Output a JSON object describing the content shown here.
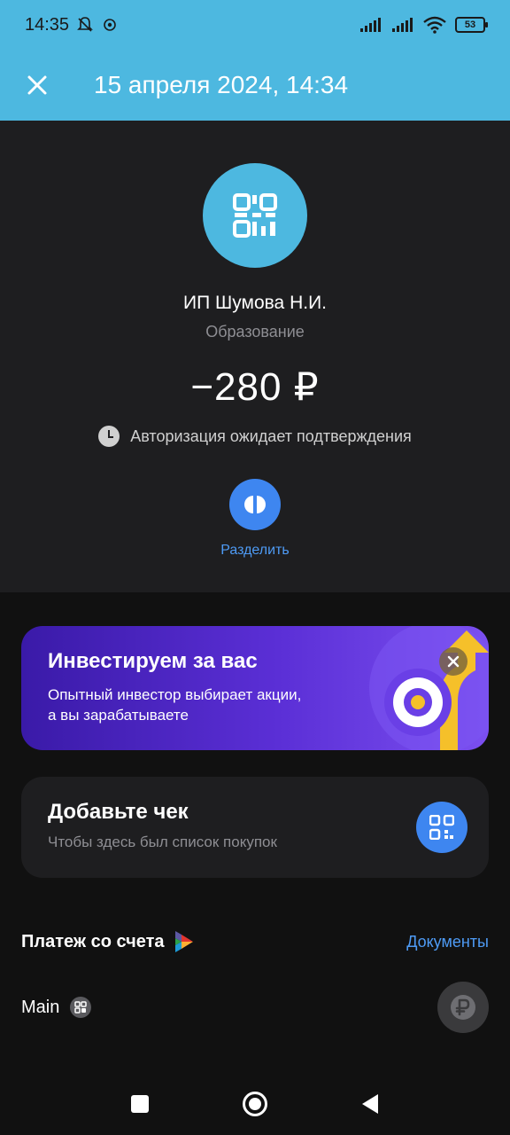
{
  "status_bar": {
    "time": "14:35",
    "battery": "53",
    "icons": [
      "bell-off-icon",
      "settings-badge-icon",
      "signal-icon",
      "signal-icon",
      "wifi-icon",
      "battery-icon"
    ]
  },
  "header": {
    "close_icon": "close-icon",
    "title": "15 апреля 2024, 14:34"
  },
  "transaction": {
    "merchant_icon": "qr-code-icon",
    "merchant_name": "ИП Шумова Н.И.",
    "category": "Образование",
    "amount": "−280 ₽",
    "status": "Авторизация ожидает подтверждения",
    "split_label": "Разделить"
  },
  "promo": {
    "title": "Инвестируем за вас",
    "text": "Опытный инвестор выбирает акции, а вы зарабатываете"
  },
  "receipt": {
    "title": "Добавьте чек",
    "subtitle": "Чтобы здесь был список покупок"
  },
  "payment": {
    "title": "Платеж со счета",
    "documents_link": "Документы",
    "account_name": "Main"
  },
  "colors": {
    "header_bg": "#4db8e0",
    "accent_blue": "#3e86f0",
    "link_blue": "#4e9bf5",
    "promo_purple": "#5b2fd6",
    "card_bg": "#1e1e20",
    "page_bg": "#111111"
  }
}
